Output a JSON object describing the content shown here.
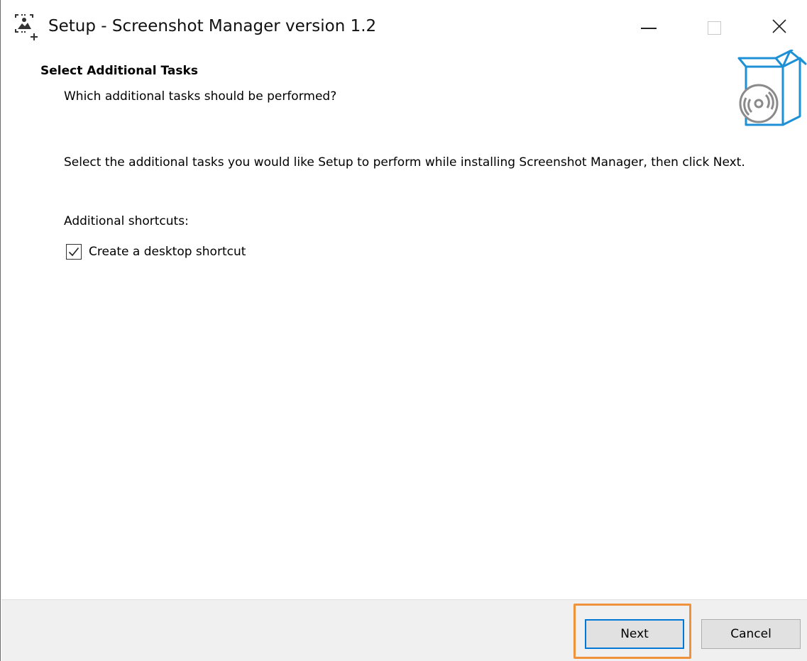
{
  "window": {
    "title": "Setup - Screenshot Manager version 1.2",
    "controls": {
      "minimize": "minimize-icon",
      "maximize": "maximize-icon",
      "close": "close-icon"
    }
  },
  "header": {
    "title": "Select Additional Tasks",
    "subtitle": "Which additional tasks should be performed?",
    "icon": "install-box-icon"
  },
  "body": {
    "intro": "Select the additional tasks you would like Setup to perform while installing Screenshot Manager, then click Next.",
    "group_label": "Additional shortcuts:",
    "tasks": [
      {
        "label": "Create a desktop shortcut",
        "checked": true
      }
    ]
  },
  "footer": {
    "next_label": "Next",
    "cancel_label": "Cancel"
  },
  "colors": {
    "accent": "#0078d7",
    "highlight": "#f0923b",
    "icon_blue": "#1e90d6",
    "footer_bg": "#f0f0f0"
  }
}
